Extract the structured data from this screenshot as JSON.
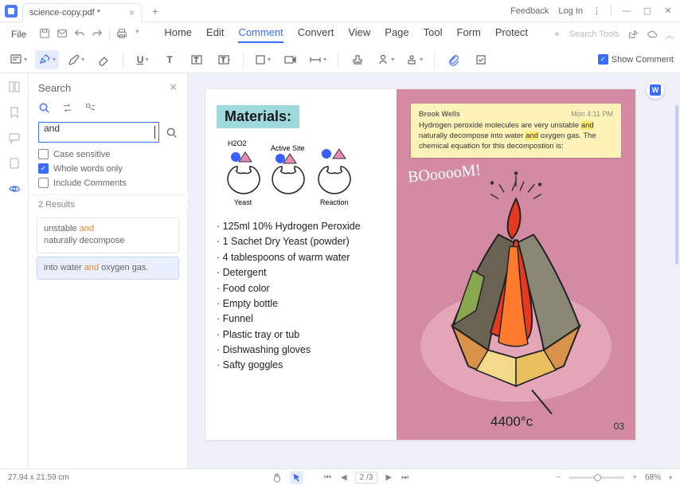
{
  "titlebar": {
    "tab_title": "science-copy.pdf *",
    "feedback": "Feedback",
    "login": "Log In"
  },
  "menu": {
    "file": "File",
    "items": [
      "Home",
      "Edit",
      "Comment",
      "Convert",
      "View",
      "Page",
      "Tool",
      "Form",
      "Protect"
    ],
    "active": "Comment",
    "search_tools": "Search Tools"
  },
  "toolbar": {
    "show_comment": "Show Comment"
  },
  "search": {
    "title": "Search",
    "value": "and",
    "opt_case": "Case sensitive",
    "opt_whole": "Whole words only",
    "opt_comments": "Include Comments",
    "results_label": "2 Results",
    "results": [
      {
        "pre": "unstable ",
        "match": "and",
        "post": "",
        "line2": "naturally decompose"
      },
      {
        "pre": "into water ",
        "match": "and",
        "post": " oxygen gas."
      }
    ]
  },
  "document": {
    "materials_label": "Materials:",
    "diagram_labels": {
      "h2o2": "H2O2",
      "active_site": "Active Site",
      "yeast": "Yeast",
      "reaction": "Reaction"
    },
    "materials_list": [
      "125ml 10% Hydrogen Peroxide",
      "1 Sachet Dry Yeast (powder)",
      "4 tablespoons of warm water",
      "Detergent",
      "Food color",
      "Empty bottle",
      "Funnel",
      "Plastic tray or tub",
      "Dishwashing gloves",
      "Safty goggles"
    ],
    "note": {
      "author": "Brook Wells",
      "time": "Mon 4:11 PM",
      "body_parts": [
        "Hydrogen peroxide molecules are very unstable ",
        " naturally decompose into water ",
        " oxygen gas. The chemical equation for this decompostion is:"
      ],
      "hl": "and"
    },
    "boom": "BOooooM!",
    "temperature": "4400°c",
    "page_num": "03"
  },
  "status": {
    "dims": "27.94 x 21.59 cm",
    "page": "2",
    "total": "/3",
    "zoom": "68%"
  }
}
